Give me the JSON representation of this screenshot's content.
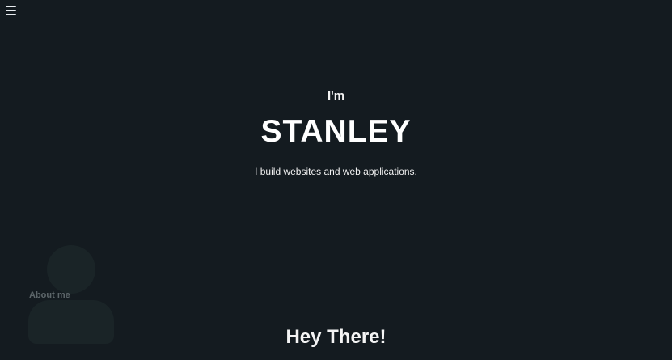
{
  "nav": {
    "menu_icon": "hamburger-icon"
  },
  "hero": {
    "intro": "I'm",
    "name": "STANLEY",
    "tagline": "I build websites and web applications."
  },
  "about": {
    "icon": "user-icon",
    "label": "About me"
  },
  "section": {
    "heading": "Hey There!"
  },
  "colors": {
    "background": "#141b20",
    "text": "#ffffff",
    "muted": "#5d666a",
    "icon_fill": "#1a2427"
  }
}
